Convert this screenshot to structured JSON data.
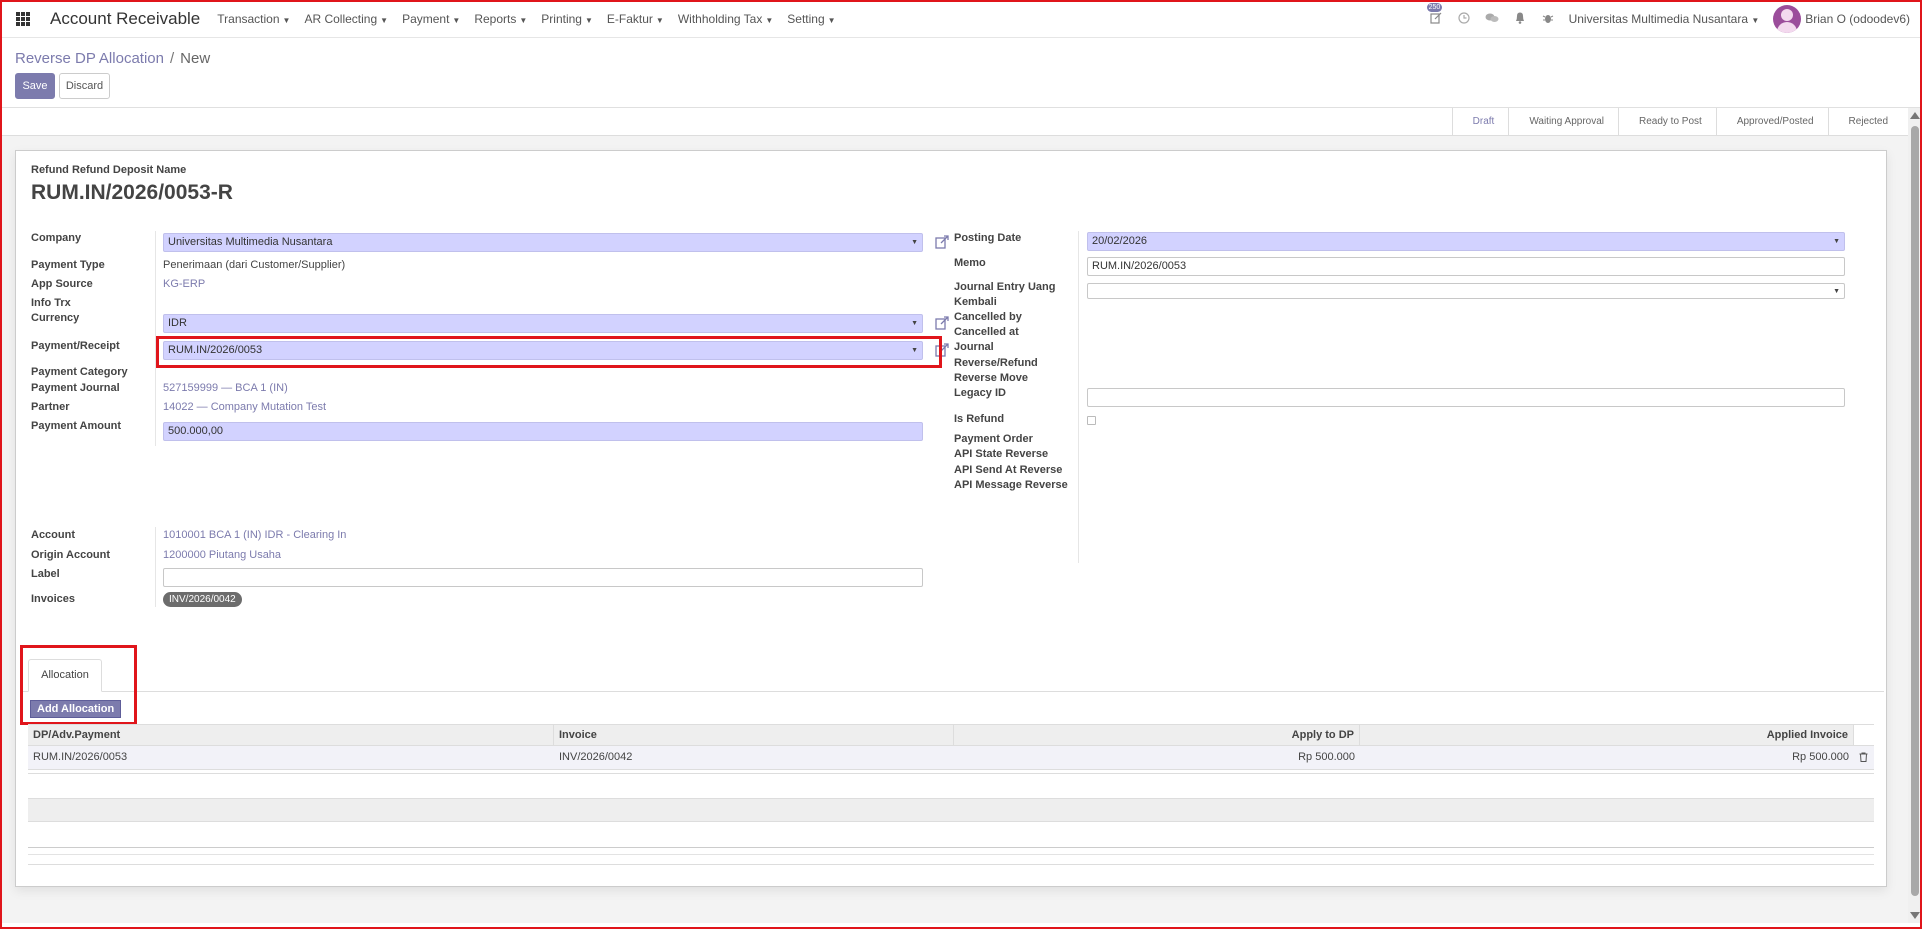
{
  "navbar": {
    "app_title": "Account Receivable",
    "menu": [
      "Transaction",
      "AR Collecting",
      "Payment",
      "Reports",
      "Printing",
      "E-Faktur",
      "Withholding Tax",
      "Setting"
    ],
    "activity_badge": "250",
    "company": "Universitas Multimedia Nusantara",
    "user": "Brian O (odoodev6)"
  },
  "breadcrumb": {
    "parent": "Reverse DP Allocation",
    "separator": "/",
    "current": "New"
  },
  "buttons": {
    "save": "Save",
    "discard": "Discard",
    "add_allocation": "Add Allocation"
  },
  "stages": [
    "Draft",
    "Waiting Approval",
    "Ready to Post",
    "Approved/Posted",
    "Rejected"
  ],
  "form": {
    "title_label": "Refund Refund Deposit Name",
    "title": "RUM.IN/2026/0053-R",
    "left": {
      "company_label": "Company",
      "company": "Universitas Multimedia Nusantara",
      "payment_type_label": "Payment Type",
      "payment_type": "Penerimaan (dari Customer/Supplier)",
      "app_source_label": "App Source",
      "app_source": "KG-ERP",
      "info_trx_label": "Info Trx",
      "currency_label": "Currency",
      "currency": "IDR",
      "payment_receipt_label": "Payment/Receipt",
      "payment_receipt": "RUM.IN/2026/0053",
      "payment_category_label": "Payment Category",
      "payment_journal_label": "Payment Journal",
      "payment_journal": "527159999 — BCA 1 (IN)",
      "partner_label": "Partner",
      "partner": "14022 — Company Mutation Test",
      "payment_amount_label": "Payment Amount",
      "payment_amount": "500.000,00",
      "account_label": "Account",
      "account": "1010001 BCA 1 (IN) IDR - Clearing In",
      "origin_account_label": "Origin Account",
      "origin_account": "1200000 Piutang Usaha",
      "label_label": "Label",
      "label_value": "",
      "invoices_label": "Invoices",
      "invoice_tag": "INV/2026/0042"
    },
    "right": {
      "posting_date_label": "Posting Date",
      "posting_date": "20/02/2026",
      "memo_label": "Memo",
      "memo": "RUM.IN/2026/0053",
      "journal_entry_label_1": "Journal Entry Uang",
      "journal_entry_label_2": "Kembali",
      "journal_entry": "",
      "cancelled_by_label": "Cancelled by",
      "cancelled_at_label": "Cancelled at",
      "journal_label": "Journal",
      "reverse_refund_label": "Reverse/Refund",
      "reverse_move_label": "Reverse Move",
      "legacy_id_label": "Legacy ID",
      "legacy_id": "",
      "is_refund_label": "Is Refund",
      "payment_order_label": "Payment Order",
      "api_state_label": "API State Reverse",
      "api_send_label": "API Send At Reverse",
      "api_message_label": "API Message Reverse"
    }
  },
  "tabs": {
    "allocation": "Allocation"
  },
  "table": {
    "headers": [
      "DP/Adv.Payment",
      "Invoice",
      "Apply to DP",
      "Applied Invoice"
    ],
    "rows": [
      {
        "dp": "RUM.IN/2026/0053",
        "invoice": "INV/2026/0042",
        "apply_to_dp": "Rp 500.000",
        "applied_invoice": "Rp 500.000"
      }
    ]
  }
}
